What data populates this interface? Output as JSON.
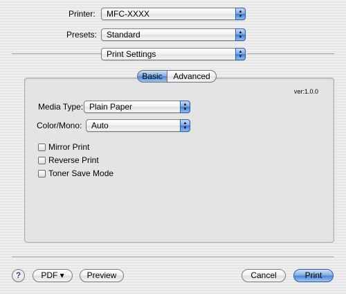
{
  "printer": {
    "label": "Printer:",
    "value": "MFC-XXXX"
  },
  "presets": {
    "label": "Presets:",
    "value": "Standard"
  },
  "section": {
    "value": "Print Settings"
  },
  "tabs": [
    {
      "label": "Basic",
      "selected": true
    },
    {
      "label": "Advanced",
      "selected": false
    }
  ],
  "version": "ver:1.0.0",
  "media_type": {
    "label": "Media Type:",
    "value": "Plain Paper"
  },
  "color_mono": {
    "label": "Color/Mono:",
    "value": "Auto"
  },
  "options": [
    {
      "label": "Mirror Print",
      "checked": false
    },
    {
      "label": "Reverse Print",
      "checked": false
    },
    {
      "label": "Toner Save Mode",
      "checked": false
    }
  ],
  "footer": {
    "help": "?",
    "pdf": "PDF ▾",
    "preview": "Preview",
    "cancel": "Cancel",
    "print": "Print"
  },
  "colors": {
    "accent": "#4a82d4",
    "help_glyph": "#5a2a9c"
  }
}
